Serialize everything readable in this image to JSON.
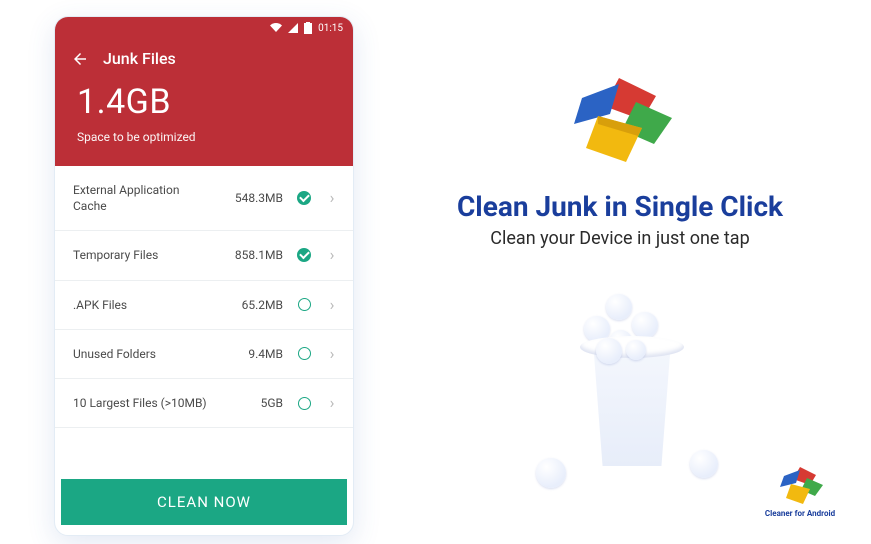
{
  "statusbar": {
    "time": "01:15"
  },
  "appbar": {
    "title": "Junk Files"
  },
  "hero": {
    "value": "1.4GB",
    "sub": "Space to be optimized"
  },
  "rows": [
    {
      "label": "External Application Cache",
      "size": "548.3MB",
      "checked": true
    },
    {
      "label": "Temporary Files",
      "size": "858.1MB",
      "checked": true
    },
    {
      "label": ".APK Files",
      "size": "65.2MB",
      "checked": false
    },
    {
      "label": "Unused Folders",
      "size": "9.4MB",
      "checked": false
    },
    {
      "label": "10 Largest Files (>10MB)",
      "size": "5GB",
      "checked": false
    }
  ],
  "clean_btn": "CLEAN NOW",
  "promo": {
    "headline": "Clean Junk in Single Click",
    "subline": "Clean your Device in just one tap",
    "brand": "Cleaner for Android"
  }
}
